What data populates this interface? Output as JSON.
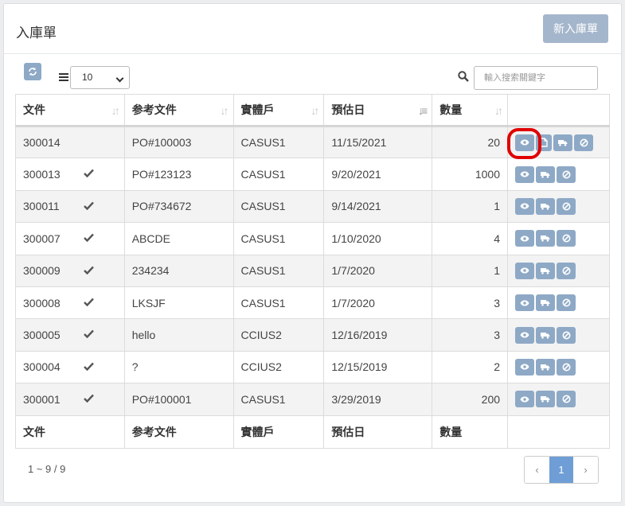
{
  "page": {
    "title": "入庫單",
    "new_button": "新入庫單"
  },
  "toolbar": {
    "page_size": "10",
    "search_placeholder": "輸入搜索關鍵字",
    "icons": [
      "refresh-icon",
      "list-icon",
      "search-icon"
    ]
  },
  "table": {
    "headers": [
      "文件",
      "参考文件",
      "實體戶",
      "預估日",
      "數量",
      ""
    ],
    "footer": [
      "文件",
      "参考文件",
      "實體戶",
      "預估日",
      "數量",
      ""
    ],
    "rows": [
      {
        "doc": "300014",
        "checked": false,
        "ref": "PO#100003",
        "entity": "CASUS1",
        "date": "11/15/2021",
        "qty": "20",
        "extra_action": true
      },
      {
        "doc": "300013",
        "checked": true,
        "ref": "PO#123123",
        "entity": "CASUS1",
        "date": "9/20/2021",
        "qty": "1000",
        "extra_action": false
      },
      {
        "doc": "300011",
        "checked": true,
        "ref": "PO#734672",
        "entity": "CASUS1",
        "date": "9/14/2021",
        "qty": "1",
        "extra_action": false
      },
      {
        "doc": "300007",
        "checked": true,
        "ref": "ABCDE",
        "entity": "CASUS1",
        "date": "1/10/2020",
        "qty": "4",
        "extra_action": false
      },
      {
        "doc": "300009",
        "checked": true,
        "ref": "234234",
        "entity": "CASUS1",
        "date": "1/7/2020",
        "qty": "1",
        "extra_action": false
      },
      {
        "doc": "300008",
        "checked": true,
        "ref": "LKSJF",
        "entity": "CASUS1",
        "date": "1/7/2020",
        "qty": "3",
        "extra_action": false
      },
      {
        "doc": "300005",
        "checked": true,
        "ref": "hello",
        "entity": "CCIUS2",
        "date": "12/16/2019",
        "qty": "3",
        "extra_action": false
      },
      {
        "doc": "300004",
        "checked": true,
        "ref": "?",
        "entity": "CCIUS2",
        "date": "12/15/2019",
        "qty": "2",
        "extra_action": false
      },
      {
        "doc": "300001",
        "checked": true,
        "ref": "PO#100001",
        "entity": "CASUS1",
        "date": "3/29/2019",
        "qty": "200",
        "extra_action": false
      }
    ]
  },
  "pagination": {
    "info": "1 ~ 9 / 9",
    "prev": "‹",
    "current": "1",
    "next": "›"
  },
  "colors": {
    "accent": "#8ea9c6",
    "primary_button": "#a4b6cb",
    "highlight_ring": "#e00000",
    "page_active": "#6f9ed6"
  }
}
